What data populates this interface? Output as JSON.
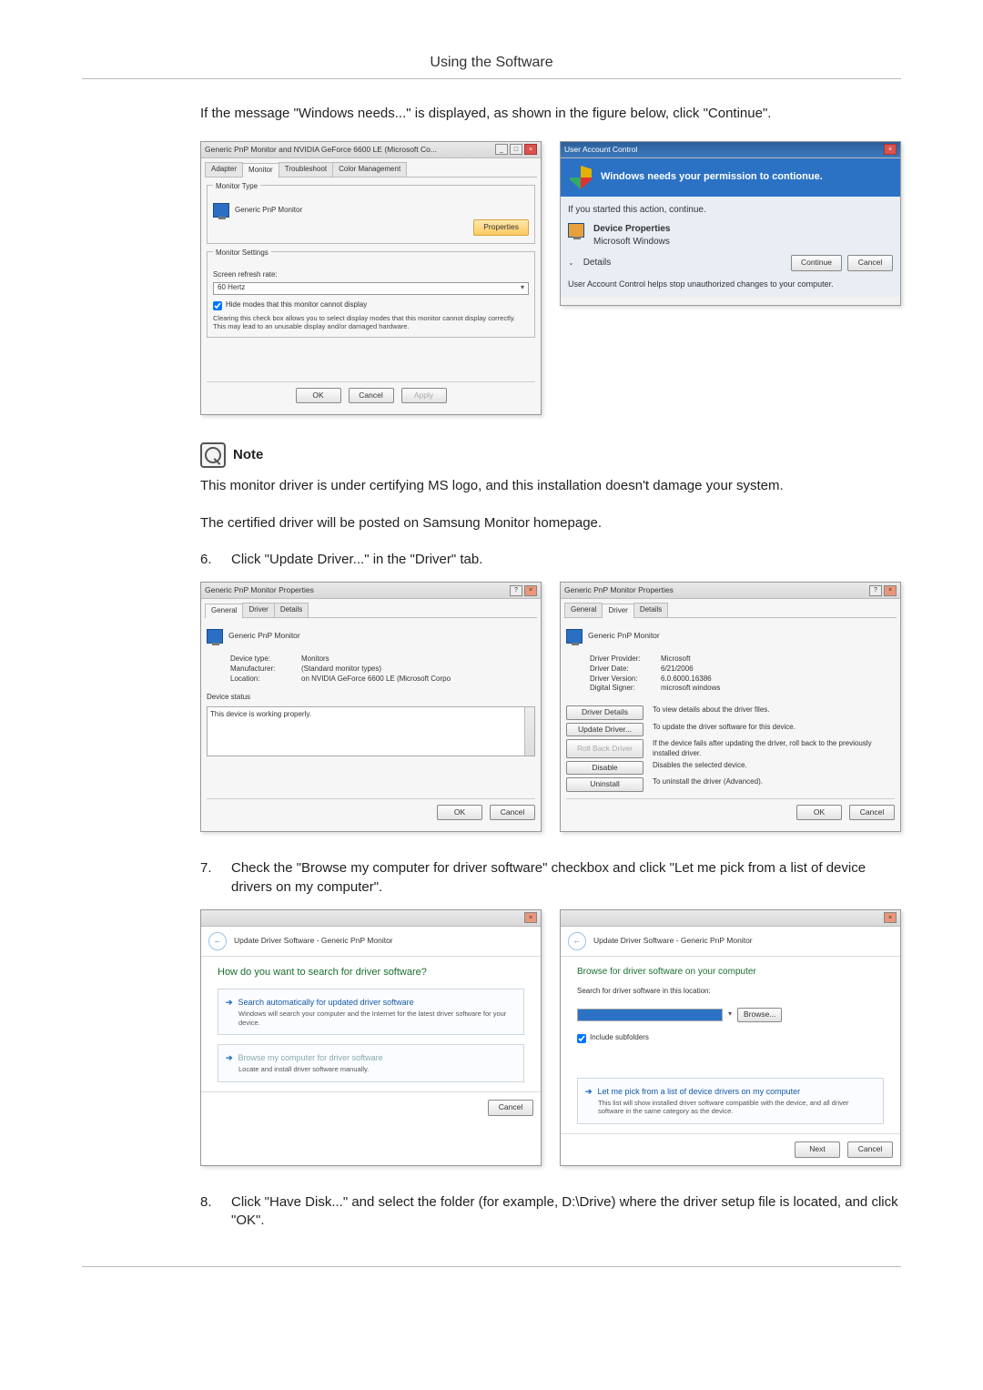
{
  "page": {
    "header_title": "Using the Software",
    "intro": "If the message \"Windows needs...\" is displayed, as shown in the figure below, click \"Continue\".",
    "note_label": "Note",
    "note_p1": "This monitor driver is under certifying MS logo, and this installation doesn't damage your system.",
    "note_p2": "The certified driver will be posted on Samsung Monitor homepage.",
    "step6_num": "6.",
    "step6": "Click \"Update Driver...\" in the \"Driver\" tab.",
    "step7_num": "7.",
    "step7": "Check the \"Browse my computer for driver software\" checkbox and click \"Let me pick from a list of device drivers on my computer\".",
    "step8_num": "8.",
    "step8": "Click \"Have Disk...\" and select the folder (for example, D:\\Drive) where the driver setup file is located, and click \"OK\"."
  },
  "fig1_left": {
    "title": "Generic PnP Monitor and NVIDIA GeForce 6600 LE (Microsoft Co...",
    "tabs": [
      "Adapter",
      "Monitor",
      "Troubleshoot",
      "Color Management"
    ],
    "monitor_type_label": "Monitor Type",
    "monitor_name": "Generic PnP Monitor",
    "properties_btn": "Properties",
    "settings_label": "Monitor Settings",
    "refresh_label": "Screen refresh rate:",
    "refresh_value": "60 Hertz",
    "hide_chk": "Hide modes that this monitor cannot display",
    "hide_desc": "Clearing this check box allows you to select display modes that this monitor cannot display correctly. This may lead to an unusable display and/or damaged hardware.",
    "ok": "OK",
    "cancel": "Cancel",
    "apply": "Apply"
  },
  "fig1_right": {
    "title": "User Account Control",
    "banner": "Windows needs your permission to contionue.",
    "started": "If you started this action, continue.",
    "prog": "Device Properties",
    "pub": "Microsoft Windows",
    "details": "Details",
    "continue": "Continue",
    "cancel": "Cancel",
    "footer": "User Account Control helps stop unauthorized changes to your computer."
  },
  "fig2_left": {
    "title": "Generic PnP Monitor Properties",
    "tabs": [
      "General",
      "Driver",
      "Details"
    ],
    "device_name": "Generic PnP Monitor",
    "kv": [
      {
        "k": "Device type:",
        "v": "Monitors"
      },
      {
        "k": "Manufacturer:",
        "v": "(Standard monitor types)"
      },
      {
        "k": "Location:",
        "v": "on NVIDIA GeForce 6600 LE (Microsoft Corpo"
      }
    ],
    "status_label": "Device status",
    "status_text": "This device is working properly.",
    "ok": "OK",
    "cancel": "Cancel"
  },
  "fig2_right": {
    "title": "Generic PnP Monitor Properties",
    "tabs": [
      "General",
      "Driver",
      "Details"
    ],
    "device_name": "Generic PnP Monitor",
    "kv": [
      {
        "k": "Driver Provider:",
        "v": "Microsoft"
      },
      {
        "k": "Driver Date:",
        "v": "6/21/2006"
      },
      {
        "k": "Driver Version:",
        "v": "6.0.6000.16386"
      },
      {
        "k": "Digital Signer:",
        "v": "microsoft windows"
      }
    ],
    "actions": [
      {
        "btn": "Driver Details",
        "desc": "To view details about the driver files."
      },
      {
        "btn": "Update Driver...",
        "desc": "To update the driver software for this device."
      },
      {
        "btn": "Roll Back Driver",
        "desc": "If the device fails after updating the driver, roll back to the previously installed driver."
      },
      {
        "btn": "Disable",
        "desc": "Disables the selected device."
      },
      {
        "btn": "Uninstall",
        "desc": "To uninstall the driver (Advanced)."
      }
    ],
    "ok": "OK",
    "cancel": "Cancel"
  },
  "fig3_left": {
    "crumb": "Update Driver Software - Generic PnP Monitor",
    "question": "How do you want to search for driver software?",
    "opt1_t": "Search automatically for updated driver software",
    "opt1_d": "Windows will search your computer and the Internet for the latest driver software for your device.",
    "opt2_t": "Browse my computer for driver software",
    "opt2_d": "Locate and install driver software manually.",
    "cancel": "Cancel"
  },
  "fig3_right": {
    "crumb": "Update Driver Software - Generic PnP Monitor",
    "heading": "Browse for driver software on your computer",
    "search_label": "Search for driver software in this location:",
    "browse": "Browse...",
    "include": "Include subfolders",
    "opt_t": "Let me pick from a list of device drivers on my computer",
    "opt_d": "This list will show installed driver software compatible with the device, and all driver software in the same category as the device.",
    "next": "Next",
    "cancel": "Cancel"
  }
}
